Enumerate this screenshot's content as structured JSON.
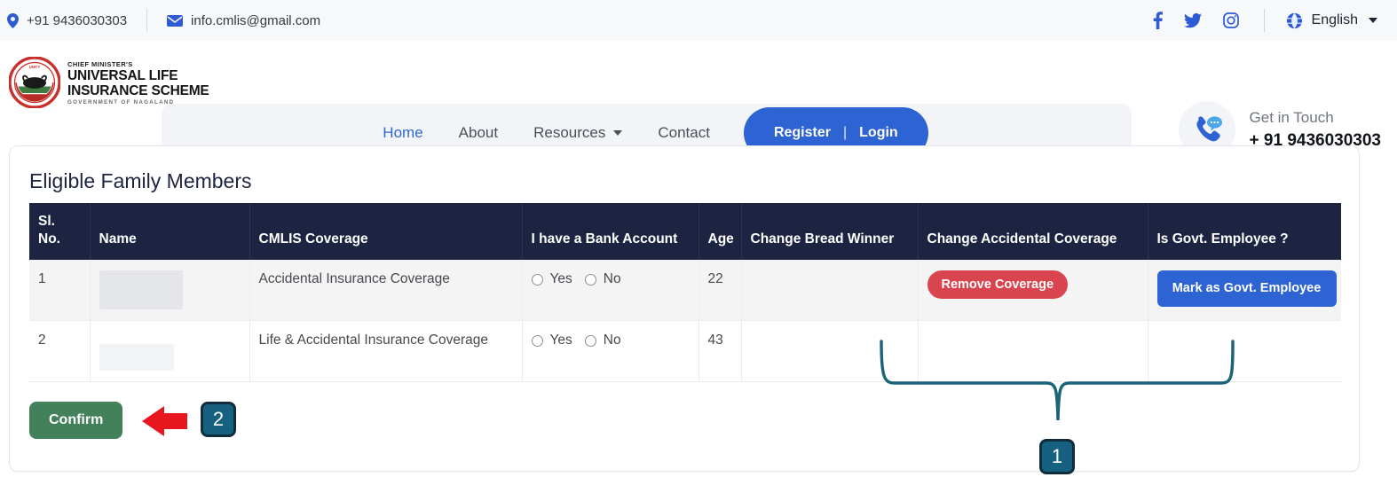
{
  "topbar": {
    "phone": "+91 9436030303",
    "email": "info.cmlis@gmail.com",
    "phone_icon": "location-pin-icon",
    "email_icon": "envelope-icon",
    "social": [
      {
        "name": "facebook-icon",
        "label": "f"
      },
      {
        "name": "twitter-icon",
        "label": ""
      },
      {
        "name": "instagram-icon",
        "label": ""
      }
    ],
    "language": "English",
    "language_icon": "globe-icon"
  },
  "logo": {
    "line1": "CHIEF MINISTER'S",
    "line2": "UNIVERSAL LIFE",
    "line3": "INSURANCE SCHEME",
    "line4": "GOVERNMENT OF NAGALAND",
    "emblem_name": "cmlis-seal-icon"
  },
  "nav": {
    "items": [
      {
        "label": "Home",
        "active": true
      },
      {
        "label": "About",
        "active": false
      },
      {
        "label": "Resources",
        "active": false,
        "caret": true
      },
      {
        "label": "Contact",
        "active": false
      }
    ],
    "register": "Register",
    "separator": "|",
    "login": "Login",
    "accent_blue": "#2d63d2"
  },
  "get_in_touch": {
    "label": "Get in Touch",
    "phone": "+ 91 9436030303",
    "icon": "phone-chat-icon"
  },
  "card": {
    "title": "Eligible Family Members"
  },
  "table": {
    "columns": [
      "Sl. No.",
      "Name",
      "CMLIS Coverage",
      "I have a Bank Account",
      "Age",
      "Change Bread Winner",
      "Change Accidental Coverage",
      "Is Govt. Employee ?"
    ],
    "header_bg": "#1c2442",
    "rows": [
      {
        "sl_no": "1",
        "name": "",
        "coverage": "Accidental Insurance Coverage",
        "bank_yes": "Yes",
        "bank_no": "No",
        "age": "22",
        "bread_winner": "",
        "accidental_action": "Remove Coverage",
        "govt_action": "Mark as Govt. Employee"
      },
      {
        "sl_no": "2",
        "name": "",
        "coverage": "Life & Accidental Insurance Coverage",
        "bank_yes": "Yes",
        "bank_no": "No",
        "age": "43",
        "bread_winner": "",
        "accidental_action": "",
        "govt_action": ""
      }
    ]
  },
  "actions": {
    "confirm": "Confirm",
    "confirm_color": "#428159",
    "remove_color": "#d9454f",
    "govt_color": "#2d63d2"
  },
  "annotations": {
    "badge_one": "1",
    "badge_two": "2",
    "badge_color": "#176180",
    "arrow_color": "#e8161f",
    "brace_color": "#1b6379"
  }
}
